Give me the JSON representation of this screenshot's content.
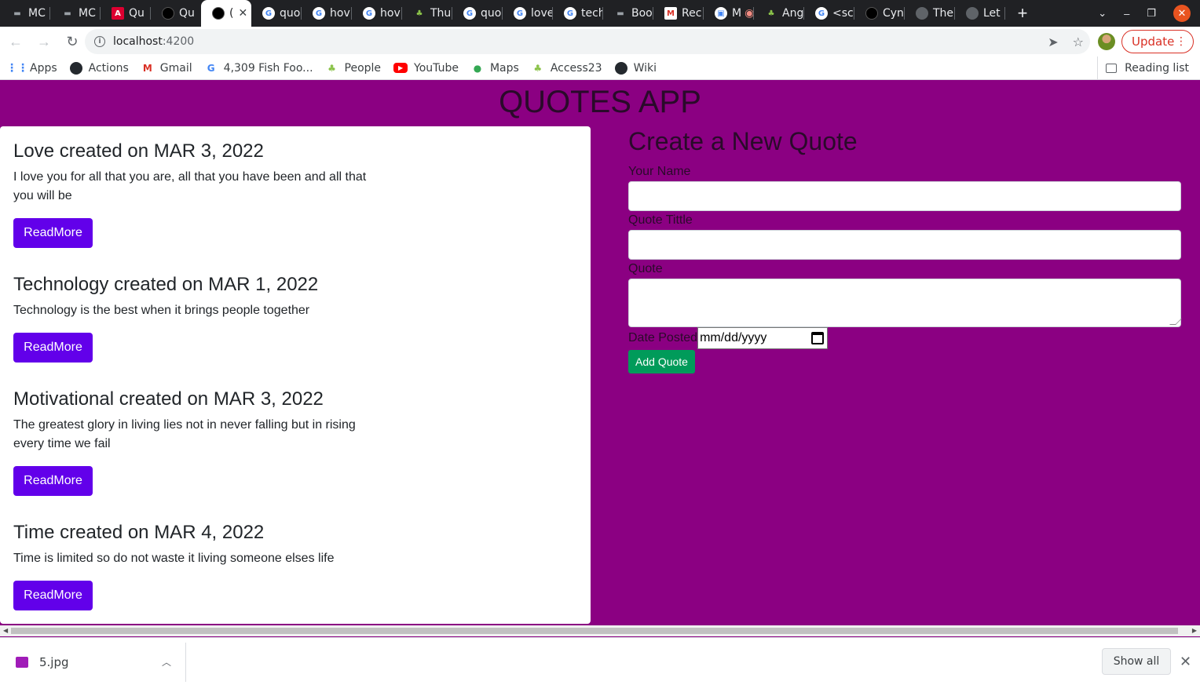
{
  "browser": {
    "tabs": [
      {
        "title": "MC",
        "icon": "folder-icon"
      },
      {
        "title": "MC",
        "icon": "folder-icon"
      },
      {
        "title": "Qu",
        "icon": "angular-icon"
      },
      {
        "title": "Qu",
        "icon": "github-icon"
      },
      {
        "title": "(",
        "icon": "github-icon",
        "active": true
      },
      {
        "title": "quo",
        "icon": "google-icon"
      },
      {
        "title": "hov",
        "icon": "google-icon"
      },
      {
        "title": "hov",
        "icon": "google-icon"
      },
      {
        "title": "Thu",
        "icon": "leaf-icon"
      },
      {
        "title": "quo",
        "icon": "google-icon"
      },
      {
        "title": "love",
        "icon": "google-icon"
      },
      {
        "title": "tech",
        "icon": "google-icon"
      },
      {
        "title": "Boo",
        "icon": "folder-icon"
      },
      {
        "title": "Rec",
        "icon": "gmail-icon"
      },
      {
        "title": "M",
        "icon": "meet-icon"
      },
      {
        "title": "Ang",
        "icon": "leaf-icon"
      },
      {
        "title": "<sc",
        "icon": "google-icon"
      },
      {
        "title": "Cyn",
        "icon": "github-icon"
      },
      {
        "title": "The",
        "icon": "globe-icon"
      },
      {
        "title": "Let",
        "icon": "globe-icon"
      }
    ],
    "url_host": "localhost",
    "url_port": ":4200",
    "update_label": "Update",
    "bookmarks": [
      {
        "label": "Apps",
        "icon": "apps-grid-icon"
      },
      {
        "label": "Actions",
        "icon": "github-icon"
      },
      {
        "label": "Gmail",
        "icon": "gmail-icon"
      },
      {
        "label": "4,309 Fish Foo...",
        "icon": "google-icon"
      },
      {
        "label": "People",
        "icon": "leaf-icon"
      },
      {
        "label": "YouTube",
        "icon": "youtube-icon"
      },
      {
        "label": "Maps",
        "icon": "maps-pin-icon"
      },
      {
        "label": "Access23",
        "icon": "leaf-icon"
      },
      {
        "label": "Wiki",
        "icon": "github-icon"
      }
    ],
    "reading_list": "Reading list"
  },
  "app": {
    "title": "QUOTES APP",
    "quotes": [
      {
        "heading": "Love created on MAR 3, 2022",
        "text": "I love you for all that you are, all that you have been and all that you will be",
        "button": "ReadMore"
      },
      {
        "heading": "Technology created on MAR 1, 2022",
        "text": "Technology is the best when it brings people together",
        "button": "ReadMore"
      },
      {
        "heading": "Motivational created on MAR 3, 2022",
        "text": "The greatest glory in living lies not in never falling but in rising every time we fail",
        "button": "ReadMore"
      },
      {
        "heading": "Time created on MAR 4, 2022",
        "text": "Time is limited so do not waste it living someone elses life",
        "button": "ReadMore"
      }
    ],
    "form": {
      "heading": "Create a New Quote",
      "name_label": "Your Name",
      "title_label": "Quote Tittle",
      "quote_label": "Quote",
      "date_label": "Date Posted",
      "date_placeholder": "mm/dd/yyyy",
      "submit_label": "Add Quote"
    }
  },
  "downloads": {
    "file": "5.jpg",
    "show_all": "Show all"
  },
  "colors": {
    "page_bg": "#8b0082",
    "readmore_bg": "#6200ea",
    "add_button_bg": "#009b5a"
  }
}
